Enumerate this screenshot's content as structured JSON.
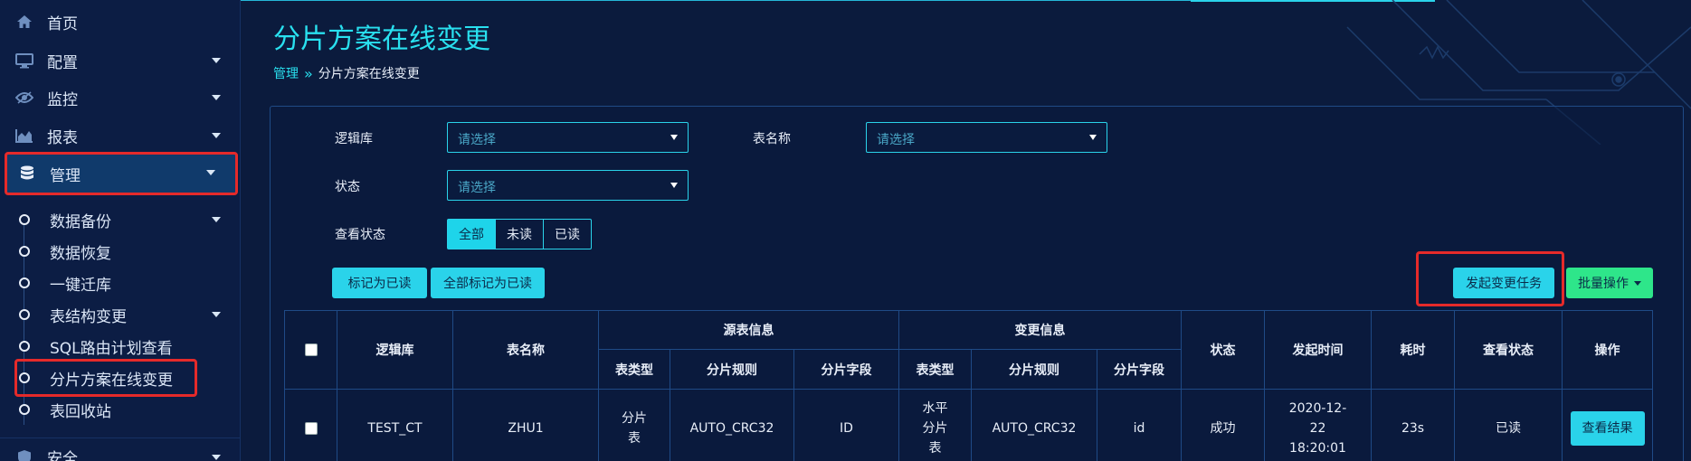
{
  "sidebar": {
    "items": [
      {
        "label": "首页",
        "icon": "home-icon"
      },
      {
        "label": "配置",
        "icon": "monitor-icon"
      },
      {
        "label": "监控",
        "icon": "eye-icon"
      },
      {
        "label": "报表",
        "icon": "area-chart-icon"
      },
      {
        "label": "管理",
        "icon": "database-icon"
      },
      {
        "label": "安全",
        "icon": "shield-icon"
      }
    ],
    "sub_items": [
      {
        "label": "数据备份"
      },
      {
        "label": "数据恢复"
      },
      {
        "label": "一键迁库"
      },
      {
        "label": "表结构变更"
      },
      {
        "label": "SQL路由计划查看"
      },
      {
        "label": "分片方案在线变更"
      },
      {
        "label": "表回收站"
      }
    ]
  },
  "page": {
    "title": "分片方案在线变更",
    "breadcrumb": {
      "parent": "管理",
      "separator": "»",
      "current": "分片方案在线变更"
    }
  },
  "filters": {
    "logic_db_label": "逻辑库",
    "logic_db_placeholder": "请选择",
    "table_name_label": "表名称",
    "table_name_placeholder": "请选择",
    "status_label": "状态",
    "status_placeholder": "请选择",
    "view_status_label": "查看状态",
    "view_status_options": [
      "全部",
      "未读",
      "已读"
    ],
    "view_status_selected": "全部"
  },
  "actions": {
    "mark_read": "标记为已读",
    "mark_all_read": "全部标记为已读",
    "start_task": "发起变更任务",
    "batch_ops": "批量操作"
  },
  "table": {
    "headers": {
      "logic_db": "逻辑库",
      "table_name": "表名称",
      "source_info": "源表信息",
      "change_info": "变更信息",
      "status": "状态",
      "start_time": "发起时间",
      "duration": "耗时",
      "view_status": "查看状态",
      "operation": "操作",
      "table_type": "表类型",
      "shard_rule": "分片规则",
      "shard_field": "分片字段"
    },
    "rows": [
      {
        "logic_db": "TEST_CT",
        "table_name": "ZHU1",
        "src_type": "分片表",
        "src_rule": "AUTO_CRC32",
        "src_field": "ID",
        "dst_type": "水平分片表",
        "dst_rule": "AUTO_CRC32",
        "dst_field": "id",
        "status": "成功",
        "start_time": "2020-12-22 18:20:01",
        "duration": "23s",
        "view_status": "已读",
        "action": "查看结果"
      }
    ]
  },
  "colors": {
    "accent": "#2ad3ea",
    "green": "#2ee68a",
    "highlight": "#e52a2a",
    "background": "#0b1b3d"
  }
}
